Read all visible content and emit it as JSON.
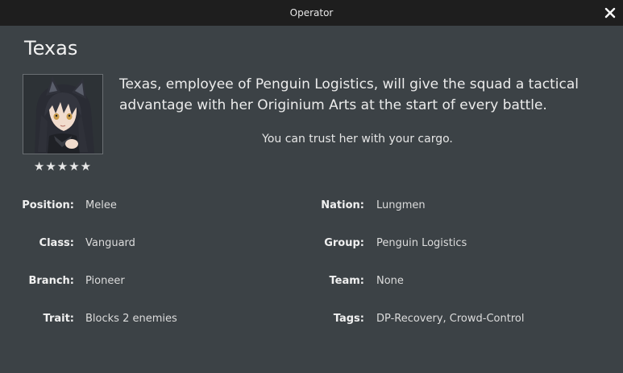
{
  "window": {
    "title": "Operator",
    "close_icon": "close-icon"
  },
  "operator": {
    "name": "Texas",
    "stars": "★★★★★",
    "rarity": 5,
    "description": "Texas, employee of Penguin Logistics, will give the squad a tactical advantage with her Originium Arts at the start of every battle.",
    "quote": "You can trust her with your cargo."
  },
  "attributes_left": [
    {
      "label": "Position:",
      "value": "Melee"
    },
    {
      "label": "Class:",
      "value": "Vanguard"
    },
    {
      "label": "Branch:",
      "value": "Pioneer"
    },
    {
      "label": "Trait:",
      "value": "Blocks 2 enemies"
    }
  ],
  "attributes_right": [
    {
      "label": "Nation:",
      "value": "Lungmen"
    },
    {
      "label": "Group:",
      "value": "Penguin Logistics"
    },
    {
      "label": "Team:",
      "value": "None"
    },
    {
      "label": "Tags:",
      "value": "DP-Recovery, Crowd-Control"
    }
  ],
  "colors": {
    "titlebar": "#1e1e1e",
    "background": "#3c4246",
    "text": "#e6e6e6"
  }
}
